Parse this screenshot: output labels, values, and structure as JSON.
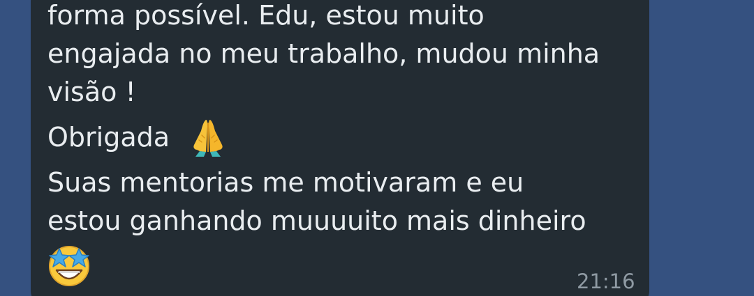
{
  "message": {
    "lines": [
      "forma possível. Edu, estou muito",
      "engajada no meu trabalho, mudou minha",
      "visão !",
      "Obrigada",
      "Suas mentorias me motivaram e eu",
      "estou ganhando muuuuito mais dinheiro"
    ],
    "emojis": {
      "after_obrigada": "folded-hands-icon",
      "last_line": "star-struck-icon"
    },
    "time": "21:16"
  },
  "colors": {
    "background": "#355180",
    "bubble": "#232c33",
    "text": "#e9edf0",
    "timestamp": "#8f9aa3"
  }
}
